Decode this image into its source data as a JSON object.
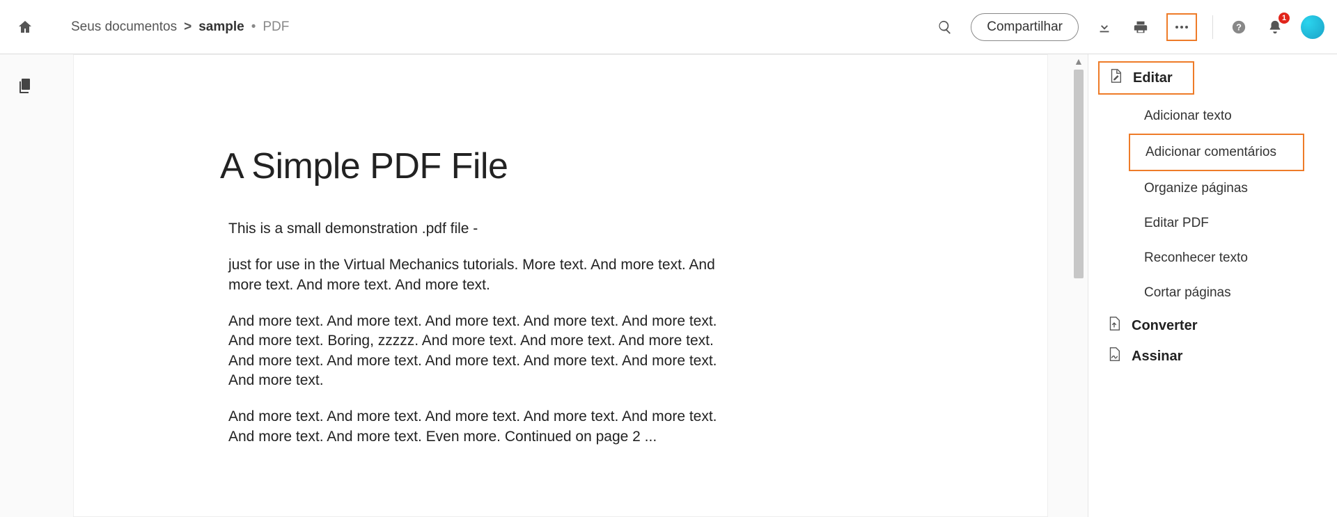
{
  "header": {
    "breadcrumb": {
      "root": "Seus documentos",
      "separator": ">",
      "current": "sample",
      "ext_sep": "•",
      "ext": "PDF"
    },
    "share_label": "Compartilhar",
    "notification_count": "1"
  },
  "document": {
    "title": "A Simple PDF File",
    "para1": "This is a small demonstration .pdf file -",
    "para2": "just for use in the Virtual Mechanics tutorials. More text. And more text. And more text. And more text. And more text.",
    "para3": "And more text. And more text. And more text. And more text. And more text. And more text. Boring, zzzzz. And more text. And more text. And more text. And more text. And more text. And more text. And more text. And more text. And more text.",
    "para4": "And more text. And more text. And more text. And more text. And more text. And more text. And more text. Even more. Continued on page 2 ..."
  },
  "rightPanel": {
    "edit": "Editar",
    "items": {
      "add_text": "Adicionar texto",
      "add_comments": "Adicionar comentários",
      "organize_pages": "Organize páginas",
      "edit_pdf": "Editar PDF",
      "recognize_text": "Reconhecer texto",
      "crop_pages": "Cortar páginas"
    },
    "convert": "Converter",
    "sign": "Assinar"
  }
}
